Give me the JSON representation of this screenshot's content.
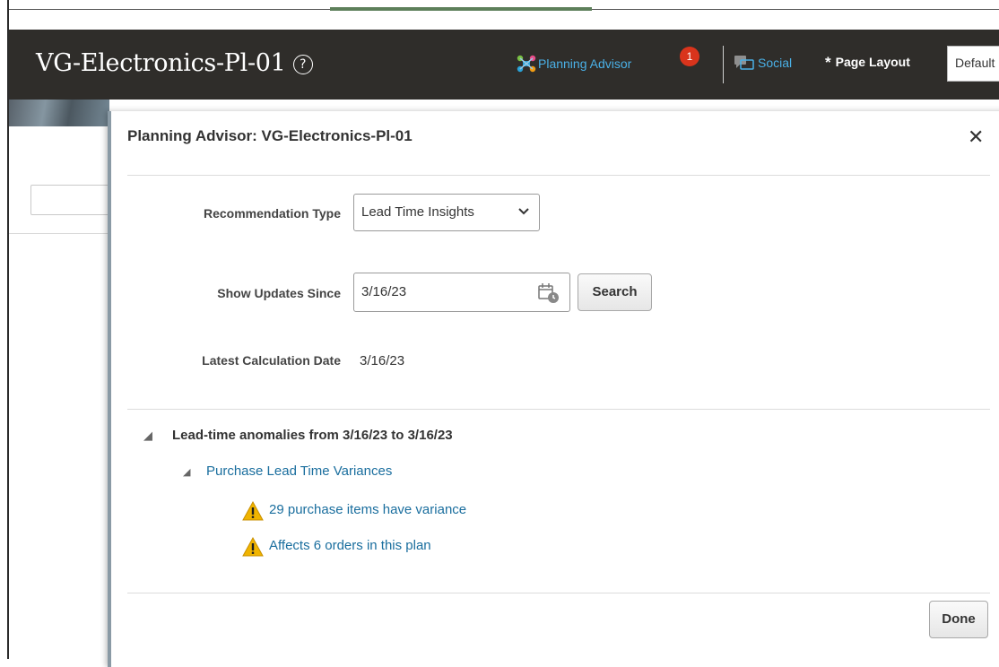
{
  "header": {
    "title": "VG-Electronics-Pl-01",
    "help_glyph": "?",
    "planning_advisor_label": "Planning Advisor",
    "notification_count": "1",
    "social_label": "Social",
    "required_mark": "*",
    "page_layout_label": "Page Layout",
    "page_layout_value": "Default",
    "icons": [
      "help-icon",
      "planning-advisor-icon",
      "social-icon"
    ]
  },
  "dialog": {
    "title": "Planning Advisor: VG-Electronics-Pl-01",
    "recommendation_type_label": "Recommendation Type",
    "recommendation_type_value": "Lead Time Insights",
    "show_updates_label": "Show Updates Since",
    "show_updates_value": "3/16/23",
    "search_label": "Search",
    "latest_calc_label": "Latest Calculation Date",
    "latest_calc_value": "3/16/23",
    "tree": {
      "heading": "Lead-time anomalies from 3/16/23 to 3/16/23",
      "group": "Purchase Lead Time Variances",
      "items": [
        "29 purchase items have variance",
        "Affects 6 orders in this plan"
      ]
    },
    "done_label": "Done"
  },
  "colors": {
    "header_bg": "#2f2d2a",
    "link": "#1a6e9e",
    "badge": "#d9341c",
    "warning": "#f0b400"
  }
}
